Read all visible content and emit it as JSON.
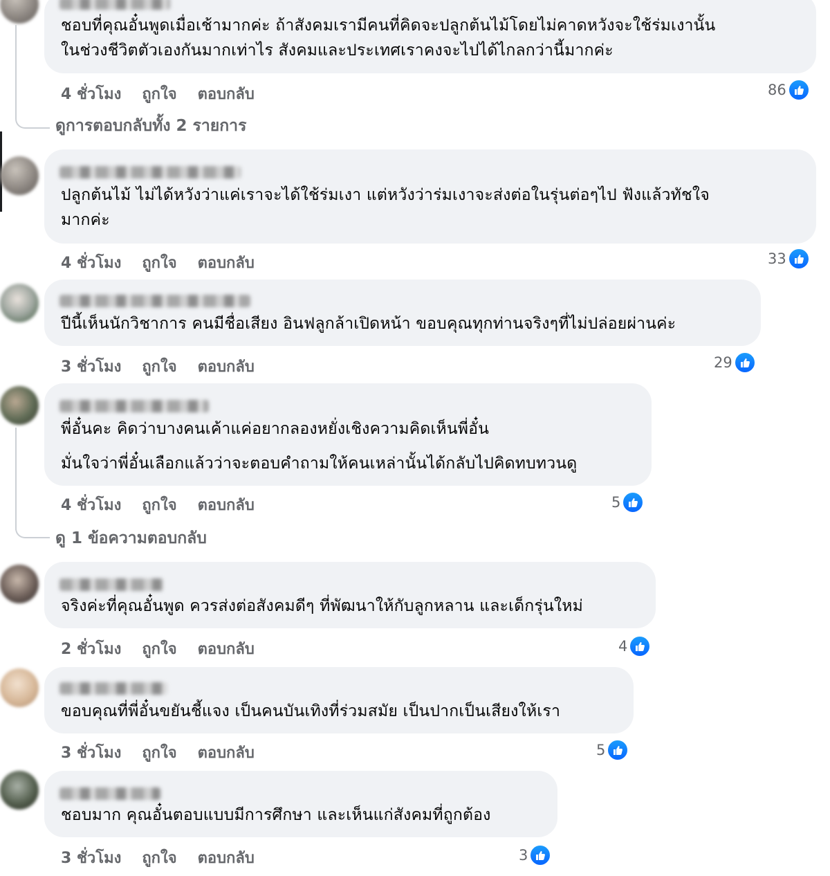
{
  "comments": [
    {
      "lines": [
        "ชอบที่คุณอั๋นพูดเมื่อเช้ามากค่ะ ถ้าสังคมเรามีคนที่คิดจะปลูกต้นไม้โดยไม่คาดหวังจะใช้ร่มเงานั้น",
        "ในช่วงชีวิตตัวเองกันมากเท่าไร สังคมและประเทศเราคงจะไปได้ไกลกว่านี้มากค่ะ"
      ],
      "time": "4 ชั่วโมง",
      "like": "ถูกใจ",
      "reply": "ตอบกลับ",
      "count": "86",
      "replies_label": "ดูการตอบกลับทั้ง 2 รายการ"
    },
    {
      "lines": [
        "ปลูกต้นไม้ ไม่ได้หวังว่าแค่เราจะได้ใช้ร่มเงา แต่หวังว่าร่มเงาจะส่งต่อในรุ่นต่อๆไป ฟังแล้วทัชใจ",
        "มากค่ะ"
      ],
      "time": "4 ชั่วโมง",
      "like": "ถูกใจ",
      "reply": "ตอบกลับ",
      "count": "33"
    },
    {
      "lines": [
        "ปีนี้เห็นนักวิชาการ คนมีชื่อเสียง อินฟลูกล้าเปิดหน้า ขอบคุณทุกท่านจริงๆที่ไม่ปล่อยผ่านค่ะ"
      ],
      "time": "3 ชั่วโมง",
      "like": "ถูกใจ",
      "reply": "ตอบกลับ",
      "count": "29"
    },
    {
      "lines": [
        "พี่อั๋นคะ คิดว่าบางคนเค้าแค่อยากลองหยั่งเชิงความคิดเห็นพี่อั๋น",
        "มั่นใจว่าพี่อั๋นเลือกแล้วว่าจะตอบคำถามให้คนเหล่านั้นได้กลับไปคิดทบทวนดู"
      ],
      "time": "4 ชั่วโมง",
      "like": "ถูกใจ",
      "reply": "ตอบกลับ",
      "count": "5",
      "replies_label": "ดู 1 ข้อความตอบกลับ"
    },
    {
      "lines": [
        "จริงค่ะที่คุณอั๋นพูด ควรส่งต่อสังคมดีๆ ที่พัฒนาให้กับลูกหลาน และเด็กรุ่นใหม่"
      ],
      "time": "2 ชั่วโมง",
      "like": "ถูกใจ",
      "reply": "ตอบกลับ",
      "count": "4"
    },
    {
      "lines": [
        "ขอบคุณที่พี่อั๋นขยันชี้แจง เป็นคนบันเทิงที่ร่วมสมัย เป็นปากเป็นเสียงให้เรา"
      ],
      "time": "3 ชั่วโมง",
      "like": "ถูกใจ",
      "reply": "ตอบกลับ",
      "count": "5"
    },
    {
      "lines": [
        "ชอบมาก คุณอั๋นตอบแบบมีการศึกษา และเห็นแก่สังคมที่ถูกต้อง"
      ],
      "time": "3 ชั่วโมง",
      "like": "ถูกใจ",
      "reply": "ตอบกลับ",
      "count": "3"
    }
  ],
  "colors": {
    "bubble": "#f0f2f5",
    "meta": "#65676b",
    "like_blue": "#0866ff"
  },
  "icons": {
    "reaction": "thumbs-up-icon"
  }
}
